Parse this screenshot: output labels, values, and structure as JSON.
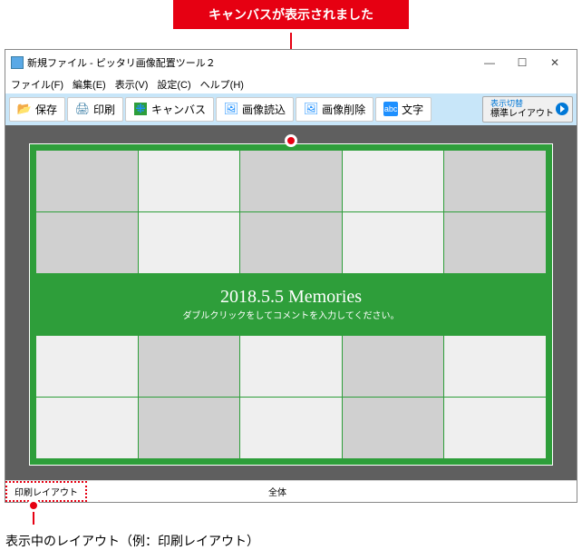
{
  "annotations": {
    "top_callout": "キャンバスが表示されました",
    "bottom_caption": "表示中のレイアウト（例：印刷レイアウト）"
  },
  "window": {
    "title": "新規ファイル - ピッタリ画像配置ツール２",
    "controls": {
      "min": "—",
      "max": "☐",
      "close": "✕"
    }
  },
  "menu": {
    "file": "ファイル(F)",
    "edit": "編集(E)",
    "view": "表示(V)",
    "settings": "設定(C)",
    "help": "ヘルプ(H)"
  },
  "toolbar": {
    "save": "保存",
    "print": "印刷",
    "canvas": "キャンバス",
    "image_load": "画像読込",
    "image_delete": "画像削除",
    "text": "文字",
    "layout_toggle_label": "表示切替",
    "layout_toggle_value": "標準レイアウト"
  },
  "canvas": {
    "title": "2018.5.5 Memories",
    "hint": "ダブルクリックをしてコメントを入力してください。",
    "grid_pattern": [
      [
        "a",
        "b",
        "a",
        "b",
        "a"
      ],
      [
        "a",
        "b",
        "a",
        "b",
        "a"
      ],
      [
        "title",
        "title",
        "title",
        "title",
        "title"
      ],
      [
        "b",
        "a",
        "b",
        "a",
        "b"
      ],
      [
        "b",
        "a",
        "b",
        "a",
        "b"
      ]
    ]
  },
  "status": {
    "tab_print": "印刷レイアウト",
    "tab_all": "全体"
  }
}
